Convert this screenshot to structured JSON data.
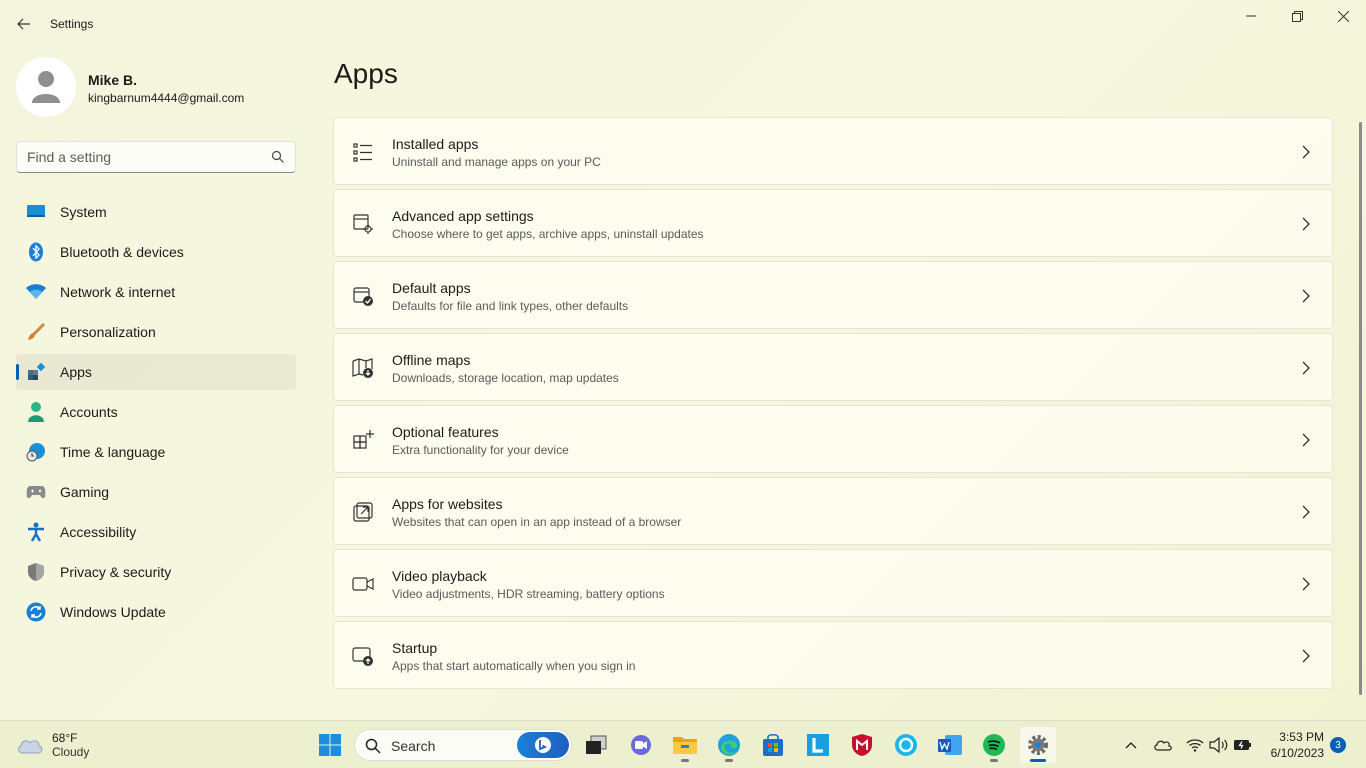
{
  "window": {
    "title": "Settings"
  },
  "profile": {
    "name": "Mike B.",
    "email": "kingbarnum4444@gmail.com"
  },
  "search": {
    "placeholder": "Find a setting"
  },
  "sidebar": {
    "items": [
      {
        "label": "System",
        "icon": "system-icon"
      },
      {
        "label": "Bluetooth & devices",
        "icon": "bluetooth-icon"
      },
      {
        "label": "Network & internet",
        "icon": "wifi-icon"
      },
      {
        "label": "Personalization",
        "icon": "brush-icon"
      },
      {
        "label": "Apps",
        "icon": "apps-icon",
        "active": true
      },
      {
        "label": "Accounts",
        "icon": "person-icon"
      },
      {
        "label": "Time & language",
        "icon": "globe-clock-icon"
      },
      {
        "label": "Gaming",
        "icon": "gamepad-icon"
      },
      {
        "label": "Accessibility",
        "icon": "accessibility-icon"
      },
      {
        "label": "Privacy & security",
        "icon": "shield-icon"
      },
      {
        "label": "Windows Update",
        "icon": "update-icon"
      }
    ]
  },
  "main": {
    "title": "Apps",
    "cards": [
      {
        "title": "Installed apps",
        "subtitle": "Uninstall and manage apps on your PC",
        "icon": "list-icon"
      },
      {
        "title": "Advanced app settings",
        "subtitle": "Choose where to get apps, archive apps, uninstall updates",
        "icon": "app-gear-icon"
      },
      {
        "title": "Default apps",
        "subtitle": "Defaults for file and link types, other defaults",
        "icon": "default-check-icon"
      },
      {
        "title": "Offline maps",
        "subtitle": "Downloads, storage location, map updates",
        "icon": "map-download-icon"
      },
      {
        "title": "Optional features",
        "subtitle": "Extra functionality for your device",
        "icon": "grid-plus-icon"
      },
      {
        "title": "Apps for websites",
        "subtitle": "Websites that can open in an app instead of a browser",
        "icon": "open-external-icon"
      },
      {
        "title": "Video playback",
        "subtitle": "Video adjustments, HDR streaming, battery options",
        "icon": "video-camera-icon"
      },
      {
        "title": "Startup",
        "subtitle": "Apps that start automatically when you sign in",
        "icon": "startup-icon"
      }
    ]
  },
  "taskbar": {
    "weather": {
      "temp": "68°F",
      "condition": "Cloudy"
    },
    "search_label": "Search",
    "clock": {
      "time": "3:53 PM",
      "date": "6/10/2023"
    },
    "notification_count": "3",
    "colors": {
      "accent": "#005fb8"
    }
  }
}
